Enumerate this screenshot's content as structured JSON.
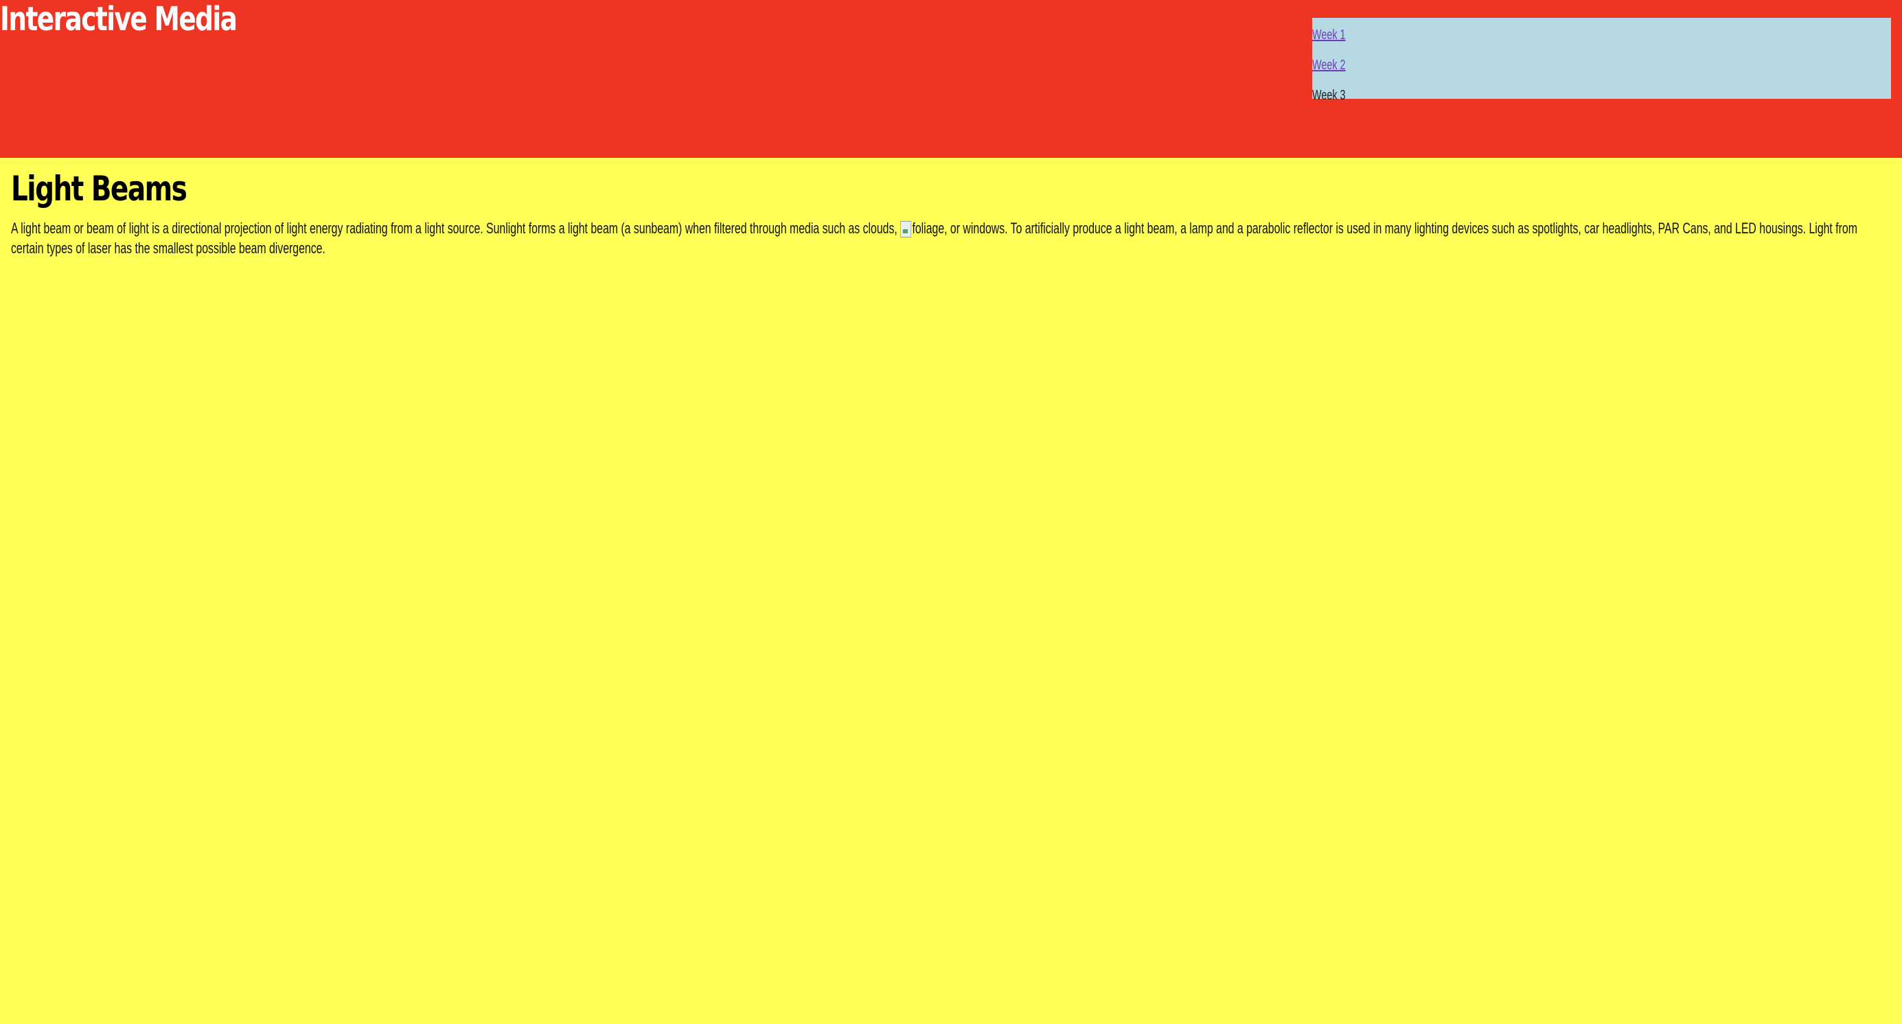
{
  "header": {
    "site_title": "Interactive Media",
    "nav": [
      {
        "label": "Week 1",
        "is_link": true
      },
      {
        "label": "Week 2",
        "is_link": true
      },
      {
        "label": "Week 3",
        "is_link": false
      }
    ]
  },
  "main": {
    "title": "Light Beams",
    "paragraph_part1": "A light beam or beam of light is a directional projection of light energy radiating from a light source. Sunlight forms a light beam (a sunbeam) when filtered through media such as clouds, ",
    "image_alt": "foliage",
    "paragraph_part2": ", or windows. To artificially produce a light beam, a lamp and a parabolic reflector is used in many lighting devices such as spotlights, car headlights, PAR Cans, and LED housings. Light from certain types of laser has the smallest possible beam divergence."
  },
  "colors": {
    "header_bg": "#ee3524",
    "page_bg": "#ffff57",
    "nav_bg": "#b7d9e3",
    "link": "#6a3dbd"
  },
  "icons": {
    "broken_image": "broken-image-icon"
  }
}
